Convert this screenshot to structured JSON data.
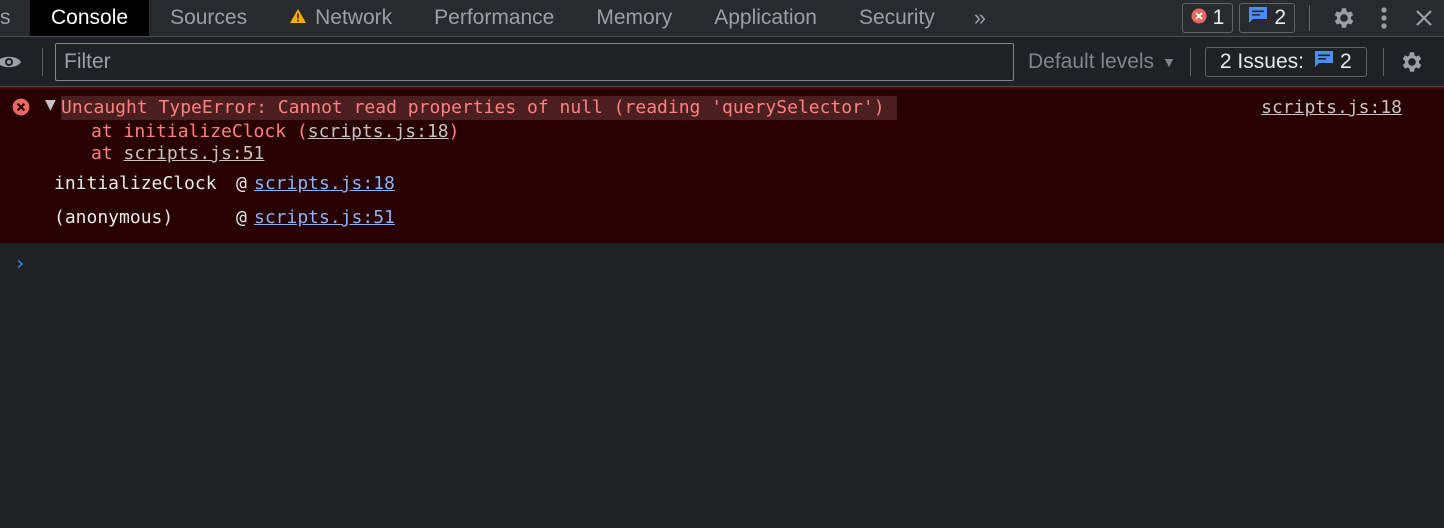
{
  "tabs": {
    "partial": "s",
    "items": [
      "Console",
      "Sources",
      "Network",
      "Performance",
      "Memory",
      "Application",
      "Security"
    ],
    "active": "Console",
    "network_warning_icon": "warning-icon"
  },
  "toolbar": {
    "error_count": "1",
    "message_count": "2"
  },
  "filter": {
    "placeholder": "Filter",
    "levels_label": "Default levels",
    "issues_label": "2 Issues:",
    "issues_count": "2"
  },
  "console": {
    "error_message": "Uncaught TypeError: Cannot read properties of null (reading 'querySelector')",
    "error_source": "scripts.js:18",
    "stack": [
      {
        "prefix": "at initializeClock (",
        "link": "scripts.js:18",
        "suffix": ")"
      },
      {
        "prefix": "at ",
        "link": "scripts.js:51",
        "suffix": ""
      }
    ],
    "trace": [
      {
        "fn": "initializeClock",
        "at": "@",
        "link": "scripts.js:18"
      },
      {
        "fn": "(anonymous)",
        "at": "@",
        "link": "scripts.js:51"
      }
    ],
    "prompt_symbol": "›"
  },
  "colors": {
    "error_bg": "#290000",
    "error_text": "#ff8080",
    "link_blue": "#8ab4f8",
    "accent_blue": "#3c8cf5"
  }
}
